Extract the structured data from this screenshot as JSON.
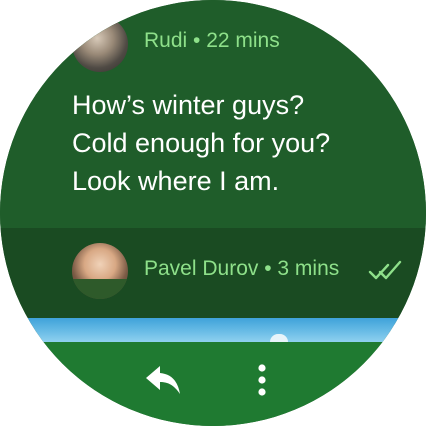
{
  "messages": [
    {
      "sender": "Rudi",
      "time": "22 mins",
      "sender_line": "Rudi • 22 mins",
      "lines": [
        "How’s winter guys?",
        "Cold enough for you?",
        "Look where I am."
      ]
    },
    {
      "sender": "Pavel Durov",
      "time": "3 mins",
      "sender_line": "Pavel Durov • 3 mins",
      "status": "read"
    }
  ],
  "icons": {
    "reply": "reply-icon",
    "more": "more-vertical-icon",
    "read": "double-check-icon"
  },
  "colors": {
    "background": "#1f5d2a",
    "second_message_background": "#1a4b22",
    "sender_text": "#8ee08a",
    "message_text": "#ffffff",
    "action_bar": "#1f7a31"
  }
}
